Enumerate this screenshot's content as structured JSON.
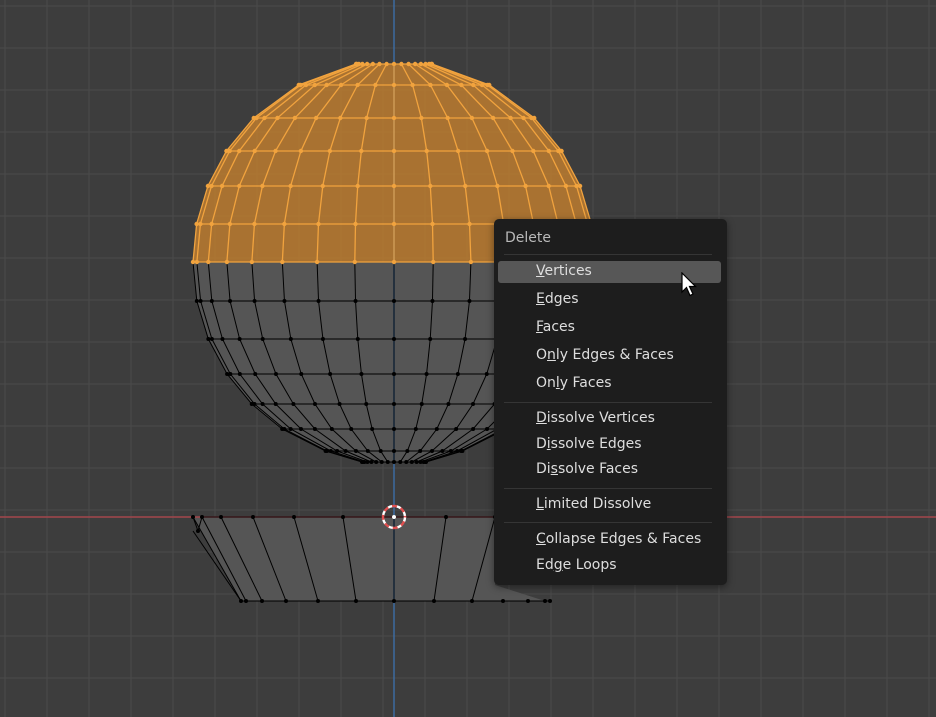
{
  "menu": {
    "title": "Delete",
    "items": [
      {
        "pre": "",
        "mn": "V",
        "post": "ertices",
        "active": true
      },
      {
        "pre": "",
        "mn": "E",
        "post": "dges",
        "active": false
      },
      {
        "pre": "",
        "mn": "F",
        "post": "aces",
        "active": false
      },
      {
        "pre": "O",
        "mn": "n",
        "post": "ly Edges & Faces",
        "active": false
      },
      {
        "pre": "On",
        "mn": "l",
        "post": "y Faces",
        "active": false
      },
      {
        "pre": "",
        "mn": "D",
        "post": "issolve Vertices",
        "active": false
      },
      {
        "pre": "D",
        "mn": "i",
        "post": "ssolve Edges",
        "active": false
      },
      {
        "pre": "Di",
        "mn": "s",
        "post": "solve Faces",
        "active": false
      },
      {
        "pre": "",
        "mn": "L",
        "post": "imited Dissolve",
        "active": false
      },
      {
        "pre": "",
        "mn": "C",
        "post": "ollapse Edges & Faces",
        "active": false
      },
      {
        "pre": "Ed",
        "mn": "g",
        "post": "e Loops",
        "active": false
      }
    ]
  },
  "scene": {
    "colors": {
      "background": "#3d3d3d",
      "grid": "#4a4a4a",
      "x_axis": "#a3464c",
      "y_axis": "#3c6ba0",
      "selected_wire": "#f1a33e",
      "selected_fill": "#c8812e",
      "unselected_wire": "#000000",
      "mesh_fill": "#555555"
    },
    "icons": [
      "3d-cursor-icon",
      "mouse-pointer-icon"
    ]
  }
}
